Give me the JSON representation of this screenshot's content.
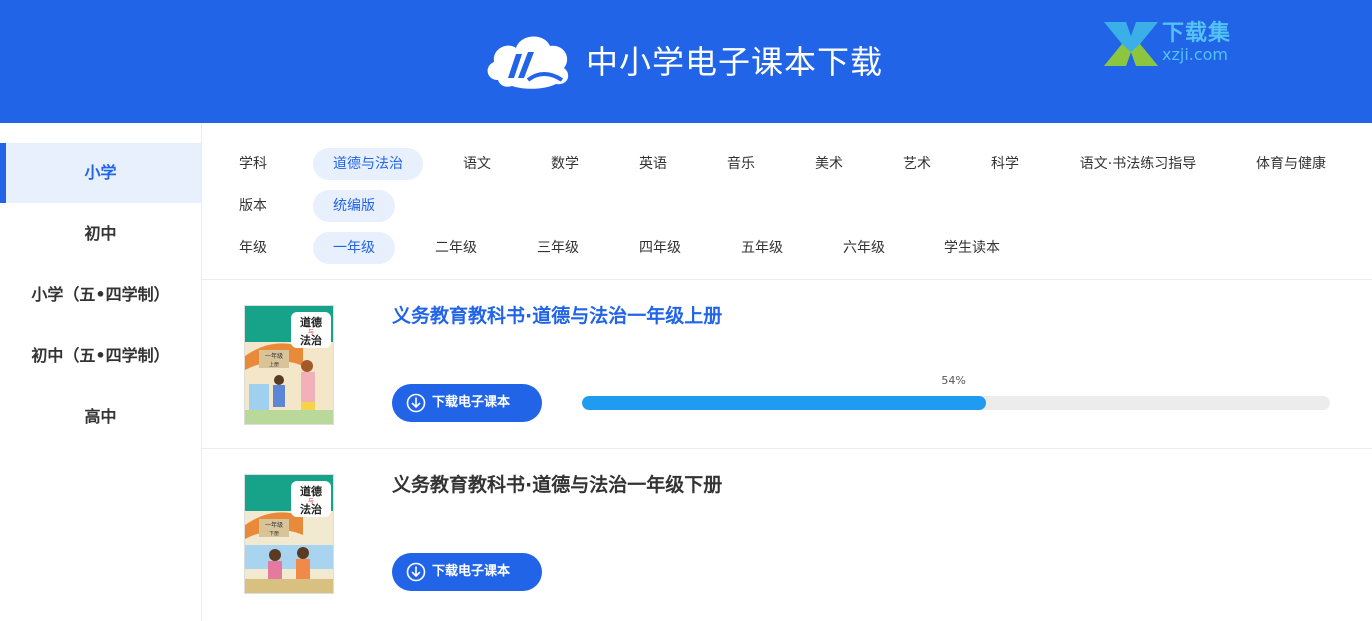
{
  "header": {
    "title": "中小学电子课本下载",
    "logo_icon": "cloud-book-logo-icon",
    "watermark": {
      "cn": "下载集",
      "en": "xzji.com"
    },
    "colors": {
      "primary": "#2164e8"
    }
  },
  "sidebar": {
    "items": [
      {
        "label": "小学",
        "active": true
      },
      {
        "label": "初中",
        "active": false
      },
      {
        "label": "小学（五•四学制）",
        "active": false
      },
      {
        "label": "初中（五•四学制）",
        "active": false
      },
      {
        "label": "高中",
        "active": false
      }
    ]
  },
  "filters": {
    "subject": {
      "label": "学科",
      "options": [
        "道德与法治",
        "语文",
        "数学",
        "英语",
        "音乐",
        "美术",
        "艺术",
        "科学",
        "语文·书法练习指导",
        "体育与健康"
      ],
      "selected": "道德与法治"
    },
    "edition": {
      "label": "版本",
      "options": [
        "统编版"
      ],
      "selected": "统编版"
    },
    "grade": {
      "label": "年级",
      "options": [
        "一年级",
        "二年级",
        "三年级",
        "四年级",
        "五年级",
        "六年级",
        "学生读本"
      ],
      "selected": "一年级"
    }
  },
  "books": [
    {
      "title": "义务教育教科书·道德与法治一年级上册",
      "download_label": "下载电子课本",
      "progress_percent": 54,
      "progress_label": "54%",
      "cover": {
        "title_line1": "道德",
        "title_mid": "与",
        "title_line2": "法治",
        "grade": "一年级",
        "volume": "上册"
      }
    },
    {
      "title": "义务教育教科书·道德与法治一年级下册",
      "download_label": "下载电子课本",
      "cover": {
        "title_line1": "道德",
        "title_mid": "与",
        "title_line2": "法治",
        "grade": "一年级",
        "volume": "下册"
      }
    }
  ]
}
